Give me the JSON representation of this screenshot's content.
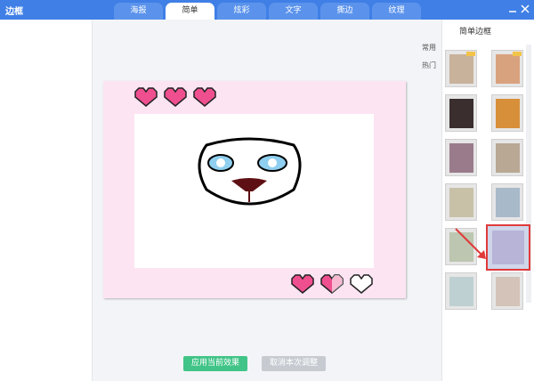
{
  "window": {
    "title": "边框"
  },
  "tabs": [
    {
      "label": "海报",
      "active": false
    },
    {
      "label": "简单",
      "active": true
    },
    {
      "label": "炫彩",
      "active": false
    },
    {
      "label": "文字",
      "active": false
    },
    {
      "label": "撕边",
      "active": false
    },
    {
      "label": "纹理",
      "active": false
    }
  ],
  "right_panel": {
    "title": "简单边框",
    "categories": [
      "常用",
      "热门"
    ],
    "thumbnails": [
      {
        "id": "t1",
        "selected": false
      },
      {
        "id": "t2",
        "selected": false
      },
      {
        "id": "t3",
        "selected": false
      },
      {
        "id": "t4",
        "selected": false
      },
      {
        "id": "t5",
        "selected": false
      },
      {
        "id": "t6",
        "selected": false
      },
      {
        "id": "t7",
        "selected": false
      },
      {
        "id": "t8",
        "selected": false
      },
      {
        "id": "t9",
        "selected": false
      },
      {
        "id": "t10",
        "selected": true
      },
      {
        "id": "t11",
        "selected": false
      },
      {
        "id": "t12",
        "selected": false
      }
    ]
  },
  "actions": {
    "apply_label": "应用当前效果",
    "cancel_label": "取消本次调整"
  },
  "colors": {
    "titlebar": "#3f7fe6",
    "frame_pink": "#fde4f3",
    "heart_pink": "#ef4f8f",
    "apply_green": "#41c487",
    "selected_border": "#e03a3a"
  },
  "icons": {
    "minimize": "minimize-icon",
    "close": "close-icon",
    "hearts": "pixel-heart-icon",
    "face": "cartoon-face-icon",
    "arrow": "red-arrow-icon"
  }
}
